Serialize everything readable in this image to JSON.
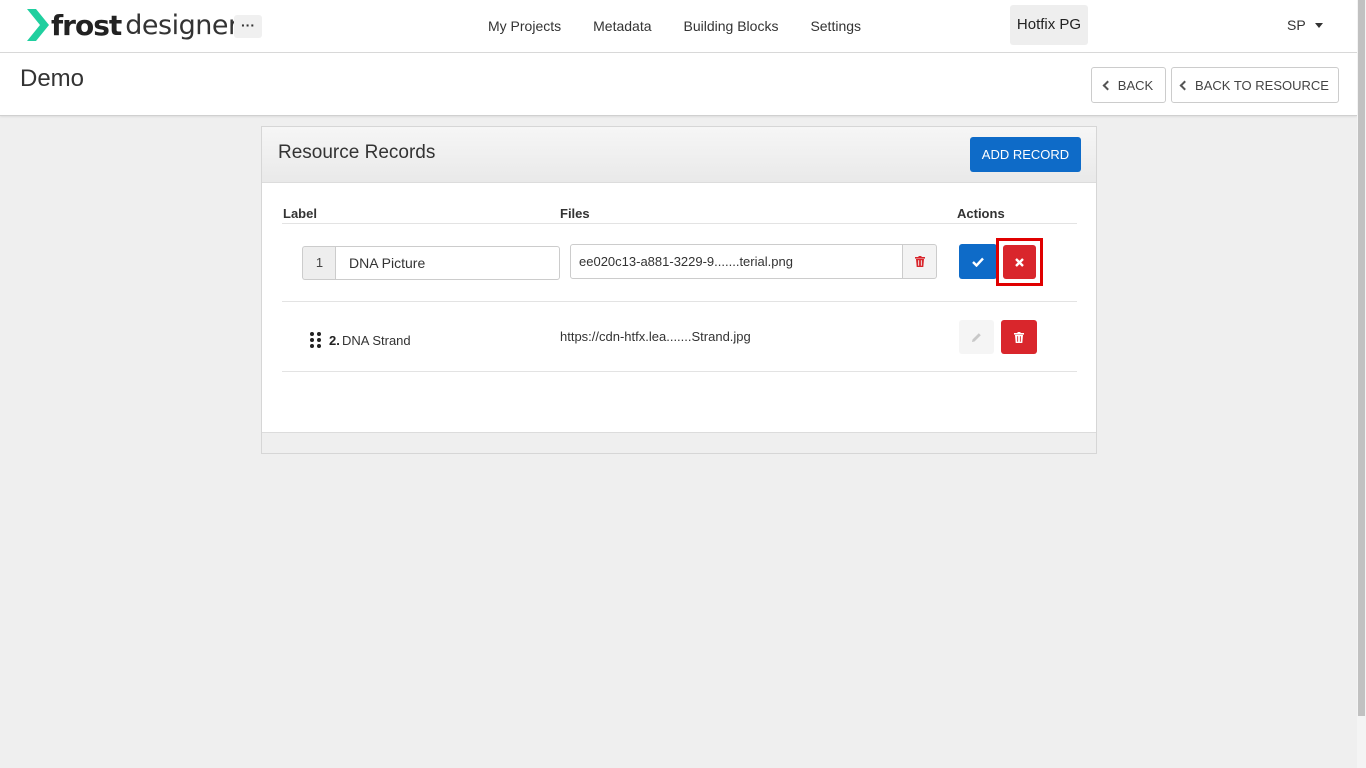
{
  "app": {
    "logo_bold": "frost",
    "logo_light": "designer",
    "more_label": "···",
    "brand_color": "#1fcf9f"
  },
  "nav": {
    "items": [
      {
        "label": "My Projects"
      },
      {
        "label": "Metadata"
      },
      {
        "label": "Building Blocks"
      },
      {
        "label": "Settings"
      }
    ],
    "project_name": "Hotfix PG",
    "user_initials": "SP"
  },
  "header": {
    "title": "Demo",
    "back_label": "BACK",
    "back_to_resource_label": "BACK TO RESOURCE"
  },
  "panel": {
    "title": "Resource Records",
    "add_label": "ADD RECORD",
    "columns": {
      "label": "Label",
      "files": "Files",
      "actions": "Actions"
    },
    "rows": [
      {
        "number": "1",
        "label": "DNA Picture",
        "file": "ee020c13-a881-3229-9.......terial.png",
        "mode": "edit"
      },
      {
        "number": "2.",
        "label": "DNA Strand",
        "file": "https://cdn-htfx.lea.......Strand.jpg",
        "mode": "view"
      }
    ]
  },
  "colors": {
    "primary": "#0e6bc8",
    "danger": "#d9262c",
    "highlight": "#e00000"
  }
}
